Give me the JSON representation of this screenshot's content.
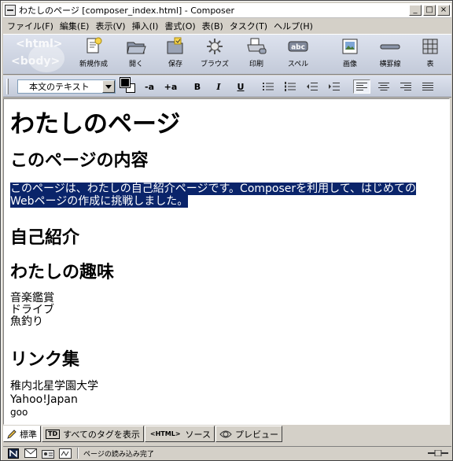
{
  "window": {
    "title": "わたしのページ [composer_index.html] - Composer",
    "minimize_glyph": "_",
    "maximize_glyph": "□",
    "close_glyph": "×"
  },
  "menu": [
    "ファイル(F)",
    "編集(E)",
    "表示(V)",
    "挿入(I)",
    "書式(O)",
    "表(B)",
    "タスク(T)",
    "ヘルプ(H)"
  ],
  "toolbar": {
    "logo_html": "<html>",
    "logo_body": "<body>",
    "buttons": [
      {
        "label": "新規作成",
        "icon": "new-doc-icon"
      },
      {
        "label": "開く",
        "icon": "open-folder-icon"
      },
      {
        "label": "保存",
        "icon": "save-icon"
      },
      {
        "label": "ブラウズ",
        "icon": "browse-icon"
      },
      {
        "label": "印刷",
        "icon": "print-icon"
      },
      {
        "label": "スペル",
        "icon": "spell-icon"
      },
      {
        "label": "画像",
        "icon": "image-icon"
      },
      {
        "label": "横罫線",
        "icon": "hr-icon"
      },
      {
        "label": "表",
        "icon": "table-icon"
      }
    ],
    "spell_badge": "abc"
  },
  "format_bar": {
    "paragraph_style": "本文のテキスト",
    "smaller_font": "-a",
    "larger_font": "+a",
    "bold": "B",
    "italic": "I",
    "underline": "U"
  },
  "document": {
    "h1": "わたしのページ",
    "h2_contents": "このページの内容",
    "intro_paragraph": "このページは、わたしの自己紹介ページです。Composerを利用して、はじめてのWebページの作成に挑戦しました。",
    "h2_profile": "自己紹介",
    "h2_hobbies": "わたしの趣味",
    "hobbies": [
      "音楽鑑賞",
      "ドライブ",
      "魚釣り"
    ],
    "h2_links": "リンク集",
    "links": [
      "稚内北星学園大学",
      "Yahoo!Japan",
      "goo"
    ]
  },
  "tabs": [
    {
      "label": "標準",
      "active": true
    },
    {
      "label": "すべてのタグを表示",
      "badge": "TD"
    },
    {
      "label": "ソース",
      "badge": "<HTML>"
    },
    {
      "label": "プレビュー"
    }
  ],
  "status": {
    "text": "ページの読み込み完了"
  },
  "colors": {
    "selection": "#0a246a",
    "chrome": "#d4d0c8",
    "toolbar_gradient_top": "#dde2ee",
    "toolbar_gradient_bottom": "#c3cad9"
  }
}
